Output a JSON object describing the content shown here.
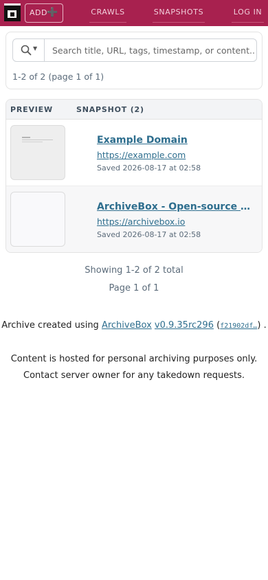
{
  "header": {
    "add_label": "ADD",
    "add_icon": "plus-icon",
    "nav": {
      "crawls": "CRAWLS",
      "snapshots": "SNAPSHOTS",
      "login": "LOG IN"
    },
    "colors": {
      "background": "#a8214f"
    }
  },
  "search": {
    "placeholder": "Search title, URL, tags, timestamp, or content...",
    "value": "",
    "result_count": "1-2 of 2 (page 1 of 1)"
  },
  "table": {
    "headers": {
      "preview": "PREVIEW",
      "snapshot": "SNAPSHOT (2)"
    },
    "rows": [
      {
        "title": "Example Domain",
        "url": "https://example.com",
        "saved": "Saved 2026-08-17 at 02:58"
      },
      {
        "title": "ArchiveBox - Open-source self-hosted web archiving",
        "url": "https://archivebox.io",
        "saved": "Saved 2026-08-17 at 02:58"
      }
    ]
  },
  "pagination": {
    "showing": "Showing 1-2 of 2 total",
    "page": "Page 1 of 1"
  },
  "footer": {
    "created_prefix": "Archive created using",
    "app_name": "ArchiveBox",
    "version": "v0.9.35rc296",
    "commit": "f21902df…",
    "notice_line1": "Content is hosted for personal archiving purposes only.",
    "notice_line2": "Contact server owner for any takedown requests."
  }
}
